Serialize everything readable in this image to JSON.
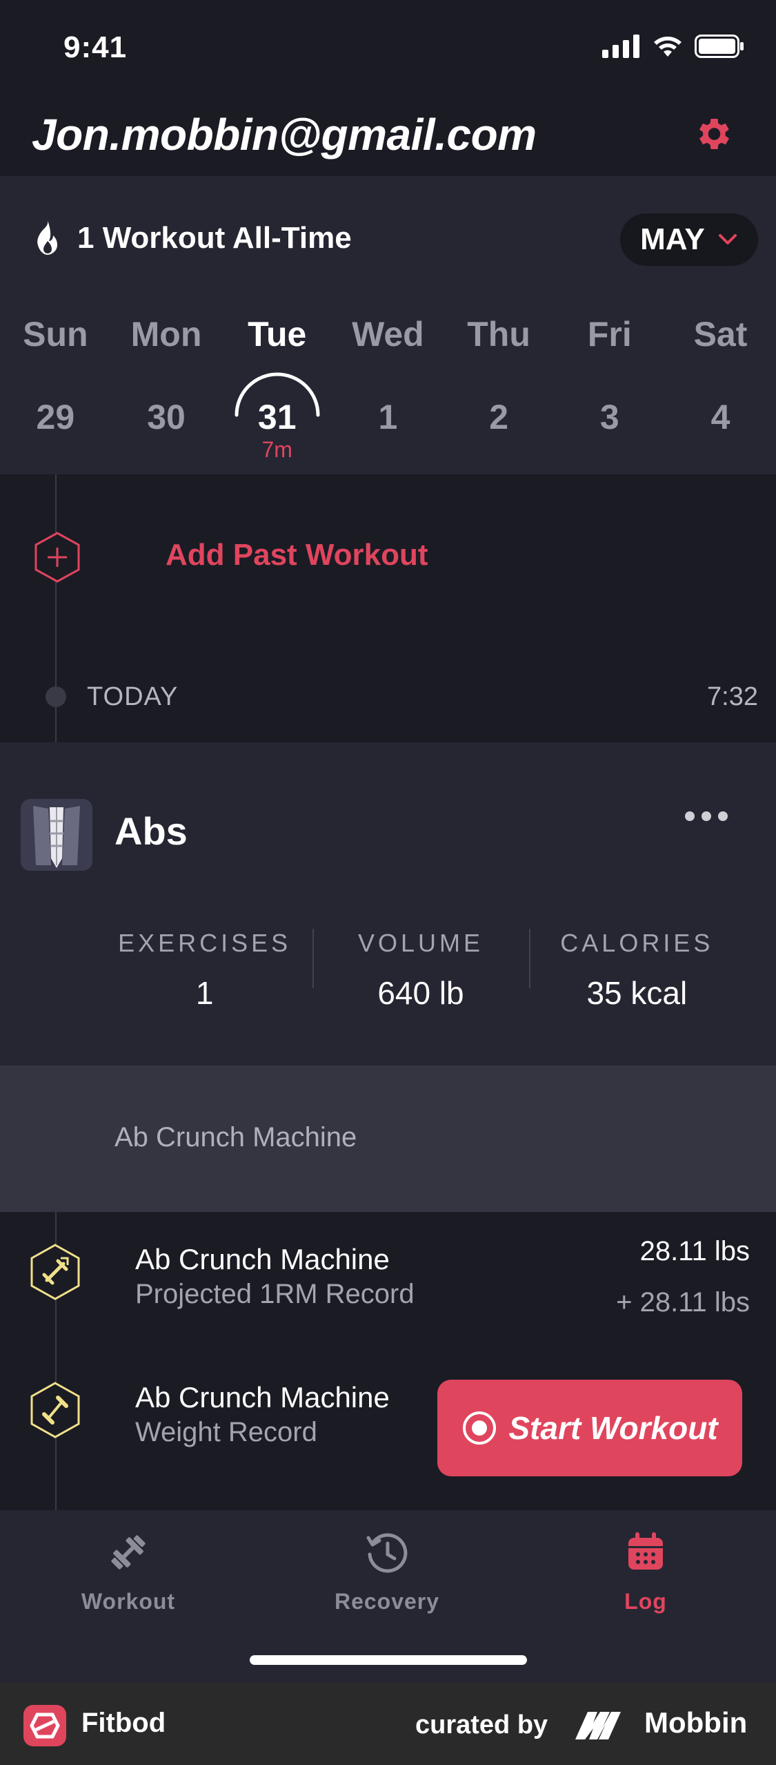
{
  "status_bar": {
    "time": "9:41"
  },
  "header": {
    "email": "Jon.mobbin@gmail.com"
  },
  "streak": {
    "label": "1 Workout All-Time"
  },
  "month": {
    "label": "MAY"
  },
  "week": [
    {
      "name": "Sun",
      "num": "29"
    },
    {
      "name": "Mon",
      "num": "30"
    },
    {
      "name": "Tue",
      "num": "31",
      "sub": "7m"
    },
    {
      "name": "Wed",
      "num": "1"
    },
    {
      "name": "Thu",
      "num": "2"
    },
    {
      "name": "Fri",
      "num": "3"
    },
    {
      "name": "Sat",
      "num": "4"
    }
  ],
  "add_past": {
    "label": "Add Past Workout"
  },
  "today": {
    "label": "TODAY",
    "time": "7:32"
  },
  "workout": {
    "title": "Abs",
    "stats": [
      {
        "label": "EXERCISES",
        "value": "1"
      },
      {
        "label": "VOLUME",
        "value": "640 lb"
      },
      {
        "label": "CALORIES",
        "value": "35 kcal"
      }
    ],
    "exercise": "Ab Crunch Machine"
  },
  "records": [
    {
      "title": "Ab Crunch Machine",
      "subtitle": "Projected 1RM Record",
      "value": "28.11 lbs",
      "delta": "+ 28.11 lbs"
    },
    {
      "title": "Ab Crunch Machine",
      "subtitle": "Weight Record"
    }
  ],
  "start_button": {
    "label": "Start Workout"
  },
  "tabs": [
    {
      "label": "Workout"
    },
    {
      "label": "Recovery"
    },
    {
      "label": "Log"
    }
  ],
  "footer": {
    "app": "Fitbod",
    "curated": "curated by",
    "brand": "Mobbin"
  },
  "colors": {
    "accent": "#e0455e",
    "background": "#1b1b24",
    "panel": "#262633",
    "record_icon": "#f0e08a"
  }
}
